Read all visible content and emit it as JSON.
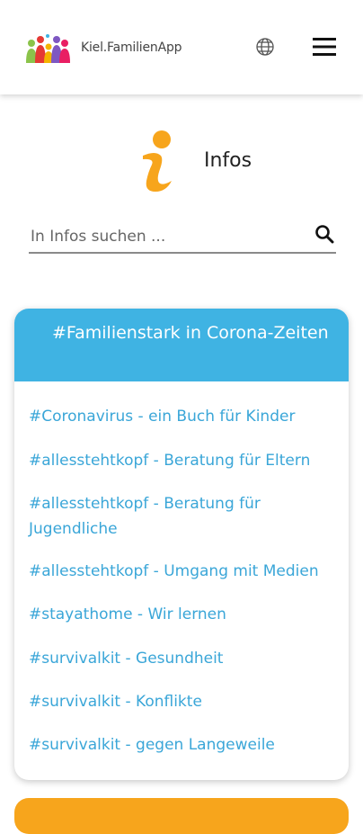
{
  "header": {
    "brand": "Kiel.FamilienApp",
    "icons": [
      "family-logo-icon",
      "globe-icon",
      "hamburger-menu-icon"
    ]
  },
  "page": {
    "title": "Infos",
    "icon": "info-icon",
    "accent_color": "#f7a51c"
  },
  "search": {
    "placeholder": "In Infos suchen ...",
    "value": "",
    "icon": "search-icon"
  },
  "card": {
    "title": "#Familienstark in Corona-Zeiten",
    "header_color": "#3fb3e3",
    "link_color": "#3aa6d8",
    "items": [
      "#Coronavirus - ein Buch für Kinder",
      "#allesstehtkopf - Beratung für Eltern",
      "#allesstehtkopf - Beratung für Jugendliche",
      "#allesstehtkopf - Umgang mit Medien",
      "#stayathome - Wir lernen",
      "#survivalkit - Gesundheit",
      "#survivalkit - Konflikte",
      "#survivalkit - gegen Langeweile"
    ]
  }
}
